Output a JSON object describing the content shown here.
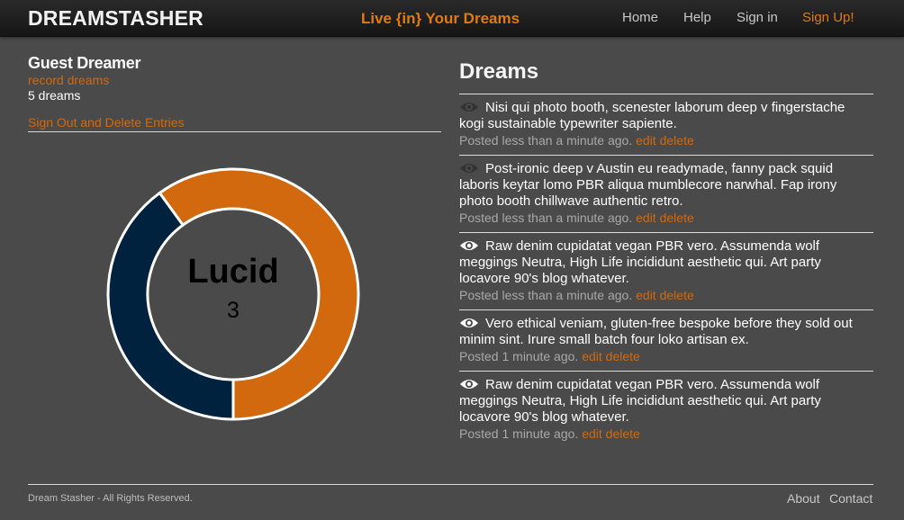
{
  "header": {
    "brand": "DREAMSTASHER",
    "tagline": "Live {in} Your Dreams",
    "nav": {
      "home": "Home",
      "help": "Help",
      "signin": "Sign in",
      "signup": "Sign Up!"
    }
  },
  "user": {
    "name": "Guest Dreamer",
    "record_link": "record dreams",
    "dream_count": "5 dreams",
    "signout_link": "Sign Out and Delete Entries"
  },
  "chart_data": {
    "type": "pie",
    "center_label": "Lucid",
    "center_value": "3",
    "slices": [
      {
        "value": 3,
        "color": "#d2690e"
      },
      {
        "value": 2,
        "color": "#00223f"
      }
    ]
  },
  "dreams": {
    "heading": "Dreams",
    "items": [
      {
        "text": "Nisi qui photo booth, scenester laborum deep v fingerstache kogi sustainable typewriter sapiente.",
        "posted": "Posted less than a minute ago.",
        "edit": "edit",
        "delete": "delete",
        "icon": "eye-icon",
        "icon_color": "#333333"
      },
      {
        "text": "Post-ironic deep v Austin eu readymade, fanny pack squid laboris keytar lomo PBR aliqua mumblecore narwhal. Fap irony photo booth chillwave authentic retro.",
        "posted": "Posted less than a minute ago.",
        "edit": "edit",
        "delete": "delete",
        "icon": "eye-icon",
        "icon_color": "#333333"
      },
      {
        "text": "Raw denim cupidatat vegan PBR vero. Assumenda wolf meggings Neutra, High Life incididunt aesthetic qui. Art party locavore 90's blog whatever.",
        "posted": "Posted less than a minute ago.",
        "edit": "edit",
        "delete": "delete",
        "icon": "eye-icon",
        "icon_color": "#ffffff"
      },
      {
        "text": "Vero ethical veniam, gluten-free bespoke before they sold out minim sint. Irure small batch four loko artisan ex.",
        "posted": "Posted 1 minute ago.",
        "edit": "edit",
        "delete": "delete",
        "icon": "eye-icon",
        "icon_color": "#ffffff"
      },
      {
        "text": "Raw denim cupidatat vegan PBR vero. Assumenda wolf meggings Neutra, High Life incididunt aesthetic qui. Art party locavore 90's blog whatever.",
        "posted": "Posted 1 minute ago.",
        "edit": "edit",
        "delete": "delete",
        "icon": "eye-icon",
        "icon_color": "#ffffff"
      }
    ]
  },
  "footer": {
    "copyright": "Dream Stasher - All Rights Reserved.",
    "about": "About",
    "contact": "Contact"
  }
}
